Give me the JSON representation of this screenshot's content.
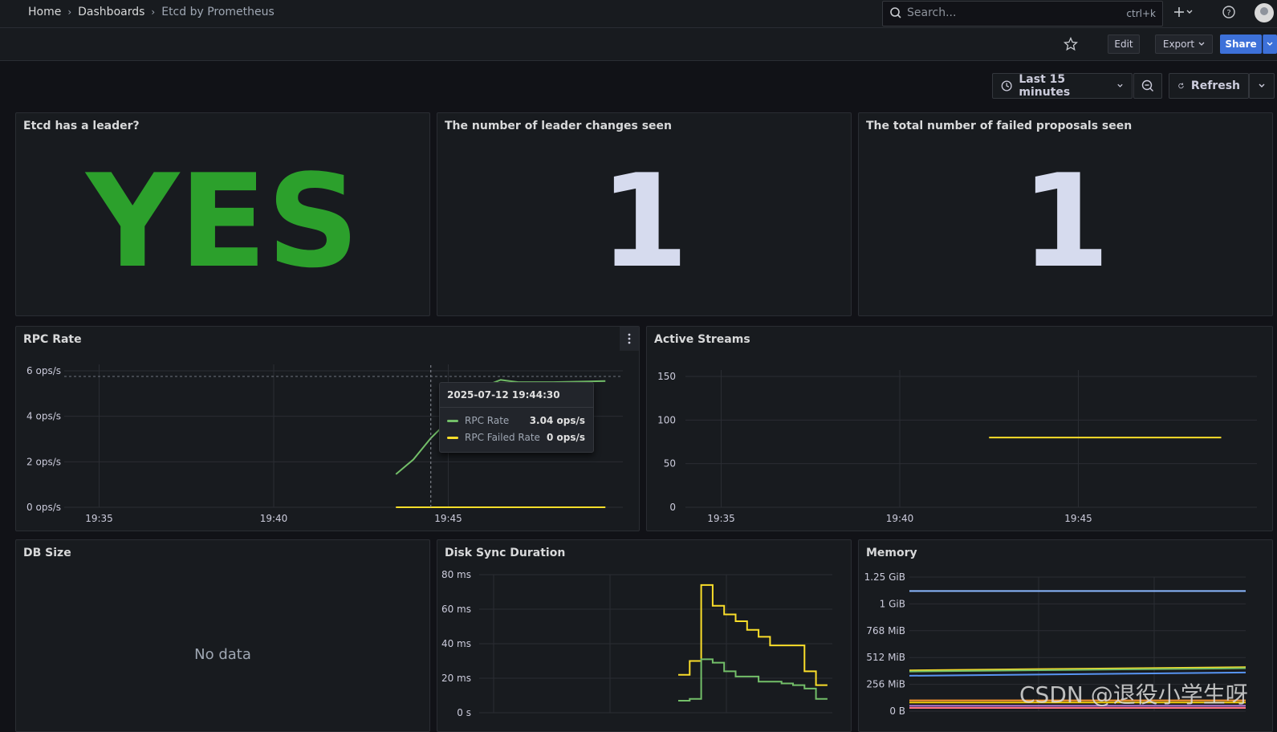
{
  "breadcrumb": [
    "Home",
    "Dashboards",
    "Etcd by Prometheus"
  ],
  "search": {
    "placeholder": "Search...",
    "shortcut": "ctrl+k"
  },
  "toolbar": {
    "edit": "Edit",
    "export": "Export",
    "share": "Share"
  },
  "timepicker": {
    "range": "Last 15 minutes",
    "refresh": "Refresh"
  },
  "panels": {
    "leader": {
      "title": "Etcd has a leader?",
      "value": "YES",
      "color": "#2ca02c"
    },
    "leader_changes": {
      "title": "The number of leader changes seen",
      "value": "1",
      "color": "#d6dbee"
    },
    "failed_proposals": {
      "title": "The total number of failed proposals seen",
      "value": "1",
      "color": "#d6dbee"
    },
    "rpc_rate": {
      "title": "RPC Rate"
    },
    "active_streams": {
      "title": "Active Streams"
    },
    "db_size": {
      "title": "DB Size",
      "message": "No data"
    },
    "disk_sync": {
      "title": "Disk Sync Duration"
    },
    "memory": {
      "title": "Memory"
    }
  },
  "tooltip": {
    "time": "2025-07-12 19:44:30",
    "rows": [
      {
        "name": "RPC Rate",
        "value": "3.04 ops/s",
        "color": "#73bf69"
      },
      {
        "name": "RPC Failed Rate",
        "value": "0 ops/s",
        "color": "#fade2a"
      }
    ]
  },
  "watermark": "CSDN @退役小学生呀",
  "chart_data": [
    {
      "panel": "RPC Rate",
      "type": "line",
      "x_ticks": [
        "19:35",
        "19:40",
        "19:45"
      ],
      "y_ticks": [
        "0 ops/s",
        "2 ops/s",
        "4 ops/s",
        "6 ops/s"
      ],
      "ylim": [
        0,
        6
      ],
      "series": [
        {
          "name": "RPC Rate",
          "color": "#73bf69",
          "x": [
            "19:43:30",
            "19:44:00",
            "19:44:30",
            "19:45:00",
            "19:45:30",
            "19:46:00",
            "19:46:30",
            "19:47:00",
            "19:48:00",
            "19:49:30"
          ],
          "values": [
            1.45,
            2.1,
            3.04,
            3.8,
            4.6,
            5.3,
            5.6,
            5.5,
            5.5,
            5.55
          ]
        },
        {
          "name": "RPC Failed Rate",
          "color": "#fade2a",
          "x": [
            "19:43:30",
            "19:49:30"
          ],
          "values": [
            0,
            0
          ]
        }
      ]
    },
    {
      "panel": "Active Streams",
      "type": "line",
      "x_ticks": [
        "19:35",
        "19:40",
        "19:45"
      ],
      "y_ticks": [
        "0",
        "50",
        "100",
        "150"
      ],
      "ylim": [
        0,
        150
      ],
      "series": [
        {
          "color": "#fade2a",
          "x": [
            "19:42:30",
            "19:49:00"
          ],
          "values": [
            80,
            80
          ]
        }
      ]
    },
    {
      "panel": "Disk Sync Duration",
      "type": "line",
      "y_ticks": [
        "0 s",
        "20 ms",
        "40 ms",
        "60 ms",
        "80 ms"
      ],
      "ylim": [
        0,
        80
      ],
      "series": [
        {
          "color": "#fade2a",
          "x": [
            0,
            1,
            2,
            3,
            4,
            5,
            6,
            7,
            8,
            9,
            10,
            11,
            12
          ],
          "values": [
            22,
            30,
            74,
            62,
            57,
            53,
            48,
            44,
            39,
            39,
            39,
            24,
            16
          ]
        },
        {
          "color": "#73bf69",
          "x": [
            0,
            1,
            2,
            3,
            4,
            5,
            6,
            7,
            8,
            9,
            10,
            11,
            12
          ],
          "values": [
            7,
            8,
            31,
            29,
            24,
            21,
            21,
            18,
            18,
            17,
            16,
            14,
            8
          ]
        }
      ]
    },
    {
      "panel": "Memory",
      "type": "line",
      "y_ticks": [
        "0 B",
        "256 MiB",
        "512 MiB",
        "768 MiB",
        "1 GiB",
        "1.25 GiB"
      ],
      "ylim": [
        0,
        1.25
      ],
      "series": [
        {
          "color": "#8ab8ff",
          "x": [
            0,
            1
          ],
          "values": [
            1.12,
            1.12
          ]
        },
        {
          "color": "#fade2a",
          "x": [
            0,
            1
          ],
          "values": [
            0.38,
            0.41
          ]
        },
        {
          "color": "#73bf69",
          "x": [
            0,
            1
          ],
          "values": [
            0.37,
            0.4
          ]
        },
        {
          "color": "#5794f2",
          "x": [
            0,
            1
          ],
          "values": [
            0.33,
            0.36
          ]
        },
        {
          "color": "#ff9830",
          "x": [
            0,
            1
          ],
          "values": [
            0.1,
            0.1
          ]
        },
        {
          "color": "#f2cc0c",
          "x": [
            0,
            1
          ],
          "values": [
            0.08,
            0.08
          ]
        },
        {
          "color": "#b877d9",
          "x": [
            0,
            1
          ],
          "values": [
            0.05,
            0.05
          ]
        },
        {
          "color": "#ff7383",
          "x": [
            0,
            1
          ],
          "values": [
            0.03,
            0.03
          ]
        }
      ]
    }
  ]
}
